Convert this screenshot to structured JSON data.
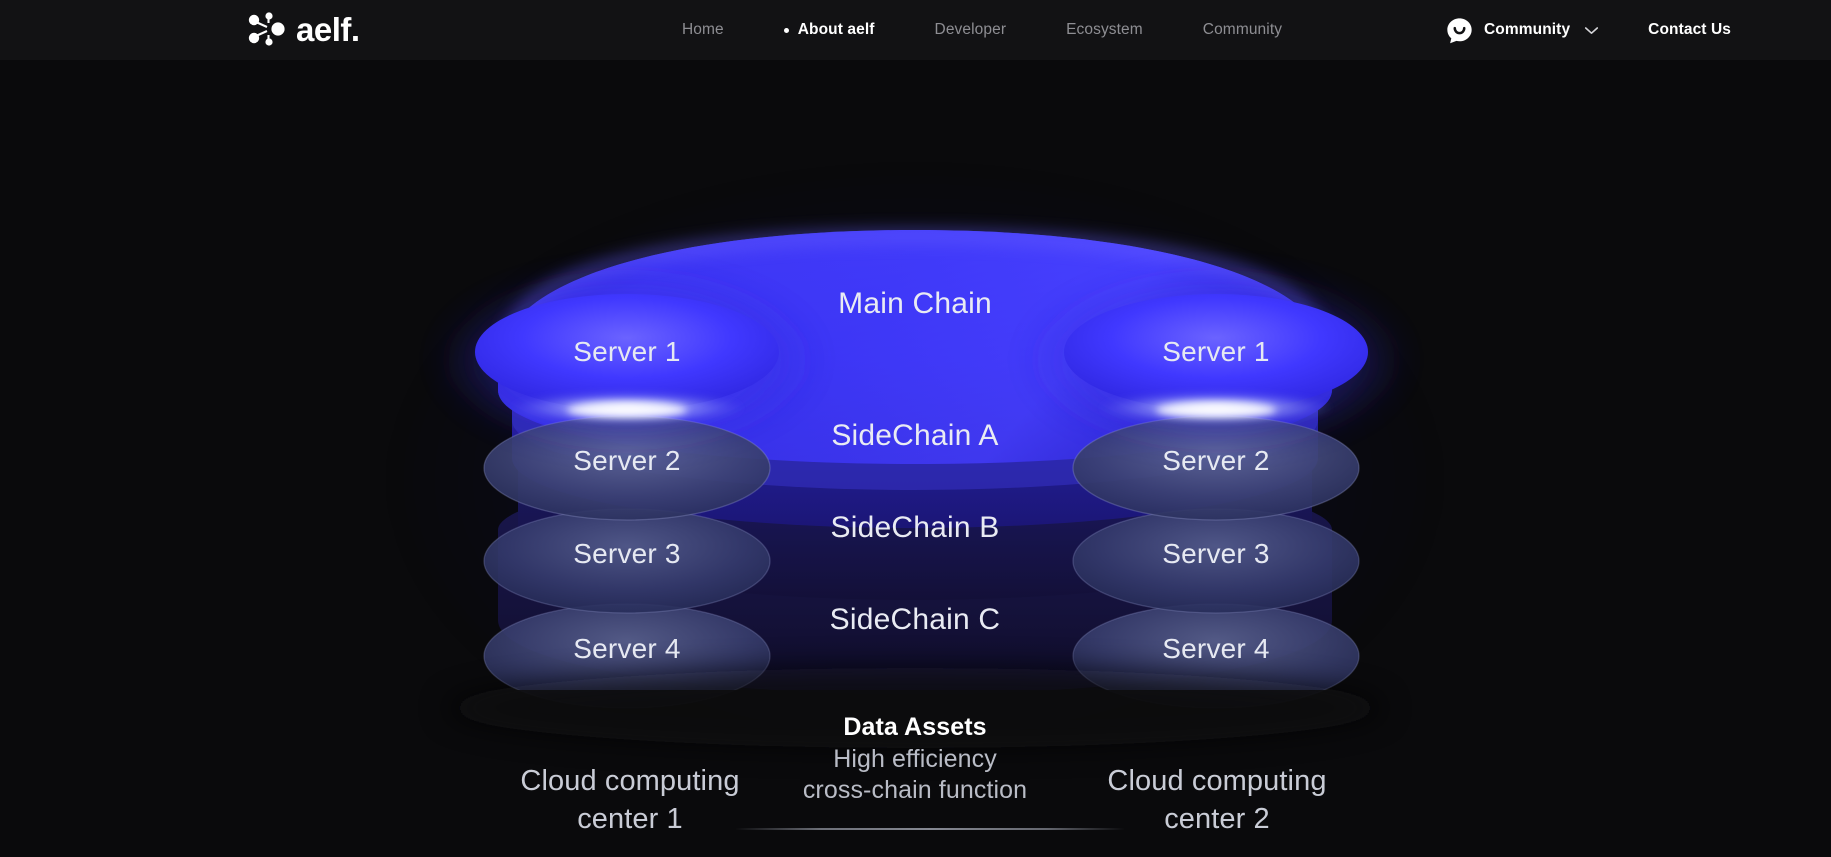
{
  "header": {
    "logo_word": "aelf.",
    "logo_icon": "aelf-node-logo-icon",
    "nav": [
      {
        "label": "Home",
        "active": false
      },
      {
        "label": "About aelf",
        "active": true
      },
      {
        "label": "Developer",
        "active": false
      },
      {
        "label": "Ecosystem",
        "active": false
      },
      {
        "label": "Community",
        "active": false
      }
    ],
    "community_button": {
      "label": "Community",
      "icon": "chat-bubble-smile-icon",
      "chevron": "chevron-down-icon"
    },
    "contact_label": "Contact Us"
  },
  "diagram": {
    "chains": [
      {
        "id": "main",
        "label": "Main Chain"
      },
      {
        "id": "sideA",
        "label": "SideChain A"
      },
      {
        "id": "sideB",
        "label": "SideChain B"
      },
      {
        "id": "sideC",
        "label": "SideChain C"
      }
    ],
    "left_servers": [
      "Server 1",
      "Server 2",
      "Server 3",
      "Server 4"
    ],
    "right_servers": [
      "Server 1",
      "Server 2",
      "Server 3",
      "Server 4"
    ],
    "left_center_label_line1": "Cloud computing",
    "left_center_label_line2": "center 1",
    "right_center_label_line1": "Cloud computing",
    "right_center_label_line2": "center 2",
    "center_title": "Data Assets",
    "center_sub_line1": "High efficiency",
    "center_sub_line2": "cross-chain function",
    "colors": {
      "page_bg": "#0a0a0c",
      "header_bg": "#121214",
      "chain_bright_blue": "#3a35f0",
      "chain_accent": "#4b46ff",
      "server_active": "#3d38ff",
      "text_primary": "#ffffff",
      "text_muted": "#8e8e93"
    }
  }
}
